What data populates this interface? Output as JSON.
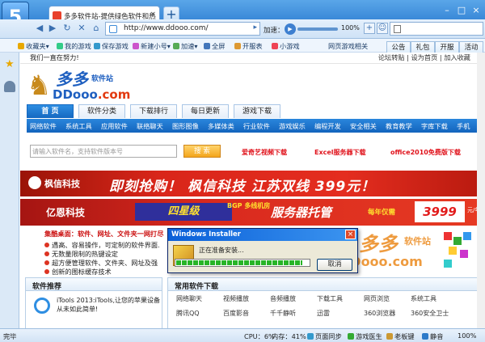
{
  "browser": {
    "tab_title": "多多软件站-提供绿色软件和热",
    "address": "http://www.ddooo.com/",
    "speed_label": "加速：",
    "volume_pct": "100%",
    "search_placeholder": ""
  },
  "favbar": {
    "items": [
      "收藏夹",
      "我的游戏",
      "保存游戏",
      "新建小号",
      "加速",
      "全屏",
      "开服表",
      "小游戏",
      "网页游戏相关"
    ]
  },
  "right_tabs": [
    "公告",
    "礼包",
    "开服",
    "活动"
  ],
  "site": {
    "welcome": "我们一直在努力!",
    "top_links": "论坛转贴 | 设为首页 | 加入收藏",
    "logo_big": "多多",
    "logo_suffix": "软件站",
    "logo_domain": "DDooo",
    "logo_tld": ".com",
    "nav": [
      "首 页",
      "软件分类",
      "下载排行",
      "每日更新",
      "游戏下载"
    ],
    "categories": [
      "网络软件",
      "系统工具",
      "应用软件",
      "联络聊天",
      "图形图像",
      "多媒体类",
      "行业软件",
      "游戏娱乐",
      "编程开发",
      "安全相关",
      "教育教学",
      "字库下载",
      "手机"
    ],
    "search_placeholder": "请输入软件名，支持软件版本号",
    "search_button": "搜 索",
    "hot_links": [
      "爱奇艺视频下载",
      "Excel服务器下载",
      "office2010免费版下载"
    ]
  },
  "banners": {
    "b1_company": "枫信科技",
    "b1_text": "即刻抢购！ 枫信科技 江苏双线 399元！",
    "b2_company": "亿恩科技",
    "b2_star": "四星级",
    "b2_bgp": "BGP 多线机房",
    "b2_host": "服务器托管",
    "b2_year": "每年仅需",
    "b2_price": "3999",
    "b2_unit": "元/年",
    "b3_title": "集酷桌面：软件、网址、文件夹一网打尽",
    "b3_lines": [
      "遇高、容易操作，可定制的软件界面.",
      "无数量限制的热键设定",
      "超方便管理软件、文件夹、网址及强",
      "创新的图标缓存技术"
    ]
  },
  "panels": {
    "left_title": "软件推荐",
    "itools_text": "iTools 2013:iTools,让您的苹果设备从未如此简单!",
    "right_title": "常用软件下载",
    "sub_row1": [
      "网络聊天",
      "视频播放",
      "音频播放",
      "下载工具",
      "网页浏览",
      "系统工具"
    ],
    "sub_row2": [
      "腾讯QQ",
      "百度影音",
      "千千静听",
      "迅雷",
      "360浏览器",
      "360安全卫士"
    ]
  },
  "watermark": {
    "big": "多多",
    "suffix": "软件站",
    "domain": "DDooo.com"
  },
  "dialog": {
    "title": "Windows Installer",
    "message": "正在准备安装...",
    "cancel": "取消",
    "progress": 0.95
  },
  "status": {
    "left": "完毕",
    "cpu": "CPU：6%",
    "mem": "内存：41%",
    "sync": "页面同步",
    "doctor": "游戏医生",
    "boss": "老板键",
    "mute": "静音",
    "zoom": "100%"
  }
}
